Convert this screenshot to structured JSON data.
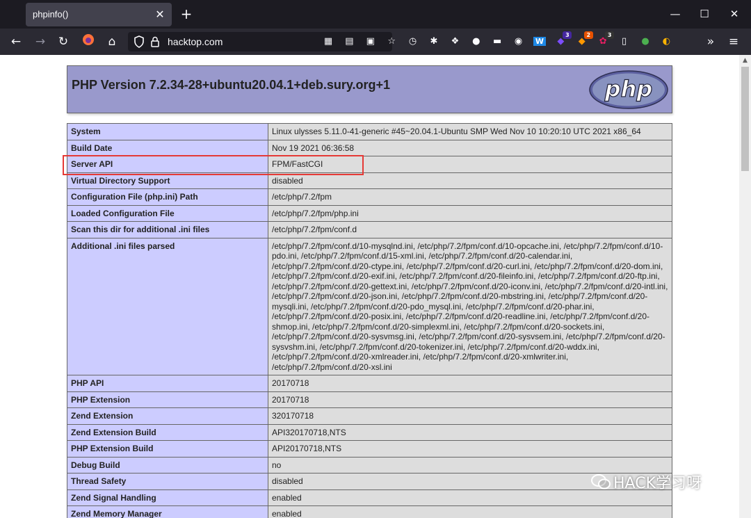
{
  "tab": {
    "title": "phpinfo()",
    "close": "✕"
  },
  "window": {
    "new_tab": "+",
    "minimize": "—",
    "maximize": "☐",
    "close": "✕"
  },
  "nav": {
    "back": "←",
    "forward": "→",
    "reload": "↻",
    "home": "⌂",
    "url": "hacktop.com",
    "overflow": "»",
    "menu": "≡"
  },
  "extensions": [
    {
      "icon": "qr-code-icon",
      "glyph": "▦"
    },
    {
      "icon": "server-icon",
      "glyph": "▤"
    },
    {
      "icon": "monitor-icon",
      "glyph": "▣"
    },
    {
      "icon": "bookmark-star-icon",
      "glyph": "☆"
    },
    {
      "icon": "history-clock-icon",
      "glyph": "◷"
    },
    {
      "icon": "bug-icon",
      "glyph": "✱"
    },
    {
      "icon": "cube-icon",
      "glyph": "❖"
    },
    {
      "icon": "ball-icon",
      "glyph": "●"
    },
    {
      "icon": "hat-icon",
      "glyph": "▬"
    },
    {
      "icon": "eye-icon",
      "glyph": "◉"
    },
    {
      "icon": "wappalyzer-icon",
      "glyph": "W"
    },
    {
      "icon": "shield-purple-icon",
      "glyph": "◆",
      "badge": "3"
    },
    {
      "icon": "fox-orange-icon",
      "glyph": "◆",
      "badge": "2"
    },
    {
      "icon": "puzzle-icon",
      "glyph": "✿",
      "badge": "3"
    },
    {
      "icon": "sidebar-icon",
      "glyph": "▯"
    },
    {
      "icon": "toggle-icon",
      "glyph": "●"
    },
    {
      "icon": "hacker-icon",
      "glyph": "◐"
    }
  ],
  "phpinfo": {
    "title": "PHP Version 7.2.34-28+ubuntu20.04.1+deb.sury.org+1",
    "logo_text": "php",
    "rows": [
      {
        "key": "System",
        "value": "Linux ulysses 5.11.0-41-generic #45~20.04.1-Ubuntu SMP Wed Nov 10 10:20:10 UTC 2021 x86_64"
      },
      {
        "key": "Build Date",
        "value": "Nov 19 2021 06:36:58"
      },
      {
        "key": "Server API",
        "value": "FPM/FastCGI"
      },
      {
        "key": "Virtual Directory Support",
        "value": "disabled"
      },
      {
        "key": "Configuration File (php.ini) Path",
        "value": "/etc/php/7.2/fpm"
      },
      {
        "key": "Loaded Configuration File",
        "value": "/etc/php/7.2/fpm/php.ini"
      },
      {
        "key": "Scan this dir for additional .ini files",
        "value": "/etc/php/7.2/fpm/conf.d"
      },
      {
        "key": "Additional .ini files parsed",
        "value": "/etc/php/7.2/fpm/conf.d/10-mysqlnd.ini, /etc/php/7.2/fpm/conf.d/10-opcache.ini, /etc/php/7.2/fpm/conf.d/10-pdo.ini, /etc/php/7.2/fpm/conf.d/15-xml.ini, /etc/php/7.2/fpm/conf.d/20-calendar.ini, /etc/php/7.2/fpm/conf.d/20-ctype.ini, /etc/php/7.2/fpm/conf.d/20-curl.ini, /etc/php/7.2/fpm/conf.d/20-dom.ini, /etc/php/7.2/fpm/conf.d/20-exif.ini, /etc/php/7.2/fpm/conf.d/20-fileinfo.ini, /etc/php/7.2/fpm/conf.d/20-ftp.ini, /etc/php/7.2/fpm/conf.d/20-gettext.ini, /etc/php/7.2/fpm/conf.d/20-iconv.ini, /etc/php/7.2/fpm/conf.d/20-intl.ini, /etc/php/7.2/fpm/conf.d/20-json.ini, /etc/php/7.2/fpm/conf.d/20-mbstring.ini, /etc/php/7.2/fpm/conf.d/20-mysqli.ini, /etc/php/7.2/fpm/conf.d/20-pdo_mysql.ini, /etc/php/7.2/fpm/conf.d/20-phar.ini, /etc/php/7.2/fpm/conf.d/20-posix.ini, /etc/php/7.2/fpm/conf.d/20-readline.ini, /etc/php/7.2/fpm/conf.d/20-shmop.ini, /etc/php/7.2/fpm/conf.d/20-simplexml.ini, /etc/php/7.2/fpm/conf.d/20-sockets.ini, /etc/php/7.2/fpm/conf.d/20-sysvmsg.ini, /etc/php/7.2/fpm/conf.d/20-sysvsem.ini, /etc/php/7.2/fpm/conf.d/20-sysvshm.ini, /etc/php/7.2/fpm/conf.d/20-tokenizer.ini, /etc/php/7.2/fpm/conf.d/20-wddx.ini, /etc/php/7.2/fpm/conf.d/20-xmlreader.ini, /etc/php/7.2/fpm/conf.d/20-xmlwriter.ini, /etc/php/7.2/fpm/conf.d/20-xsl.ini"
      },
      {
        "key": "PHP API",
        "value": "20170718"
      },
      {
        "key": "PHP Extension",
        "value": "20170718"
      },
      {
        "key": "Zend Extension",
        "value": "320170718"
      },
      {
        "key": "Zend Extension Build",
        "value": "API320170718,NTS"
      },
      {
        "key": "PHP Extension Build",
        "value": "API20170718,NTS"
      },
      {
        "key": "Debug Build",
        "value": "no"
      },
      {
        "key": "Thread Safety",
        "value": "disabled"
      },
      {
        "key": "Zend Signal Handling",
        "value": "enabled"
      },
      {
        "key": "Zend Memory Manager",
        "value": "enabled"
      }
    ]
  },
  "watermark": {
    "text": "HACK学习呀"
  },
  "colors": {
    "highlight": "#e53935",
    "php_header": "#9999cc",
    "key_cell": "#ccccff",
    "value_cell": "#dddddd"
  }
}
